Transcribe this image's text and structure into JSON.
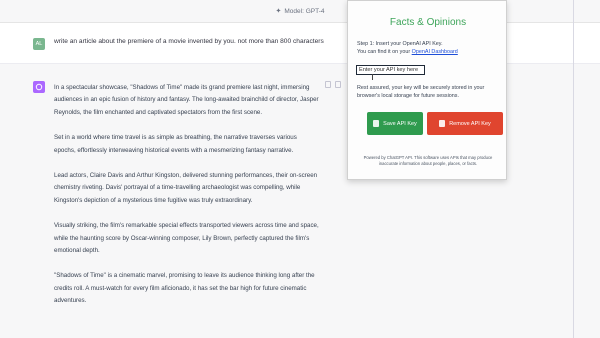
{
  "model_bar": {
    "icon": "sparkle-icon",
    "label": "Model: GPT-4"
  },
  "user_message": {
    "avatar_letter": "AL",
    "text": "write an article about the premiere of a movie invented by you. not more than 800 characters"
  },
  "assistant_message": {
    "avatar_icon": "openai-logo-icon",
    "paragraphs": [
      "In a spectacular showcase, \"Shadows of Time\" made its grand premiere last night, immersing audiences in an epic fusion of history and fantasy. The long-awaited brainchild of director, Jasper Reynolds, the film enchanted and captivated spectators from the first scene.",
      "Set in a world where time travel is as simple as breathing, the narrative traverses various epochs, effortlessly interweaving historical events with a mesmerizing fantasy narrative.",
      "Lead actors, Claire Davis and Arthur Kingston, delivered stunning performances, their on-screen chemistry riveting. Davis' portrayal of a time-travelling archaeologist was compelling, while Kingston's depiction of a mysterious time fugitive was truly extraordinary.",
      "Visually striking, the film's remarkable special effects transported viewers across time and space, while the haunting score by Oscar-winning composer, Lily Brown, perfectly captured the film's emotional depth.",
      "\"Shadows of Time\" is a cinematic marvel, promising to leave its audience thinking long after the credits roll. A must-watch for every film aficionado, it has set the bar high for future cinematic adventures."
    ]
  },
  "popup": {
    "title": "Facts & Opinions",
    "step_line1": "Step 1: Insert your OpenAI API Key.",
    "step_line2_prefix": "You can find it on your ",
    "step_link": "OpenAI Dashboard",
    "input_placeholder": "Enter your API key here",
    "reassure": "Rest assured, your key will be securely stored in your browser's local storage for future sessions.",
    "save_label": "Save API Key",
    "remove_label": "Remove API Key",
    "footer": "Powered by ChatGPT API. This software uses APIs that may produce inaccurate information about people, places, or facts."
  },
  "colors": {
    "title_green": "#3ea55a",
    "save_green": "#2f9b4e",
    "remove_red": "#e0452f",
    "link_blue": "#1d4ed8"
  }
}
